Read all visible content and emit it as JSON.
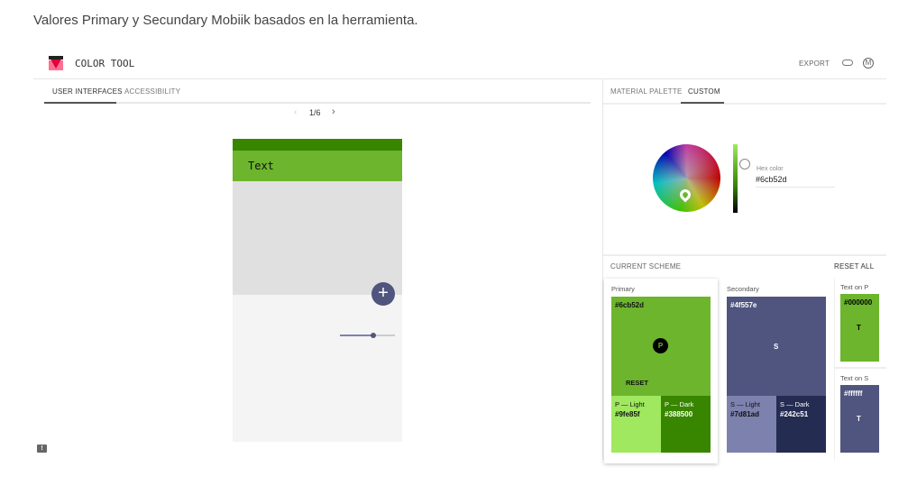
{
  "caption": "Valores Primary y Secundary Mobiik basados en la herramienta.",
  "header": {
    "title": "COLOR TOOL",
    "export_label": "EXPORT",
    "icons": [
      "link-icon",
      "material-logo-icon"
    ]
  },
  "left_tabs": [
    {
      "label": "USER INTERFACES",
      "active": true
    },
    {
      "label": "ACCESSIBILITY",
      "active": false
    }
  ],
  "pager": {
    "text": "1/6"
  },
  "preview": {
    "appbar_text": "Text",
    "slider_value": 0.6
  },
  "right_tabs": [
    {
      "label": "MATERIAL PALETTE",
      "active": false
    },
    {
      "label": "CUSTOM",
      "active": true
    }
  ],
  "picker": {
    "hex_label": "Hex color",
    "hex_value": "#6cb52d"
  },
  "scheme": {
    "title": "CURRENT SCHEME",
    "reset_all": "RESET ALL",
    "primary": {
      "label": "Primary",
      "hex": "#6cb52d",
      "badge": "P",
      "reset": "RESET",
      "light_label": "P — Light",
      "light_hex": "#9fe85f",
      "dark_label": "P — Dark",
      "dark_hex": "#388500"
    },
    "secondary": {
      "label": "Secondary",
      "hex": "#4f557e",
      "badge": "S",
      "light_label": "S — Light",
      "light_hex": "#7d81ad",
      "dark_label": "S — Dark",
      "dark_hex": "#242c51"
    },
    "text_on_p": {
      "label": "Text on P",
      "hex": "#000000",
      "badge": "T"
    },
    "text_on_s": {
      "label": "Text on S",
      "hex": "#ffffff",
      "badge": "T"
    }
  }
}
